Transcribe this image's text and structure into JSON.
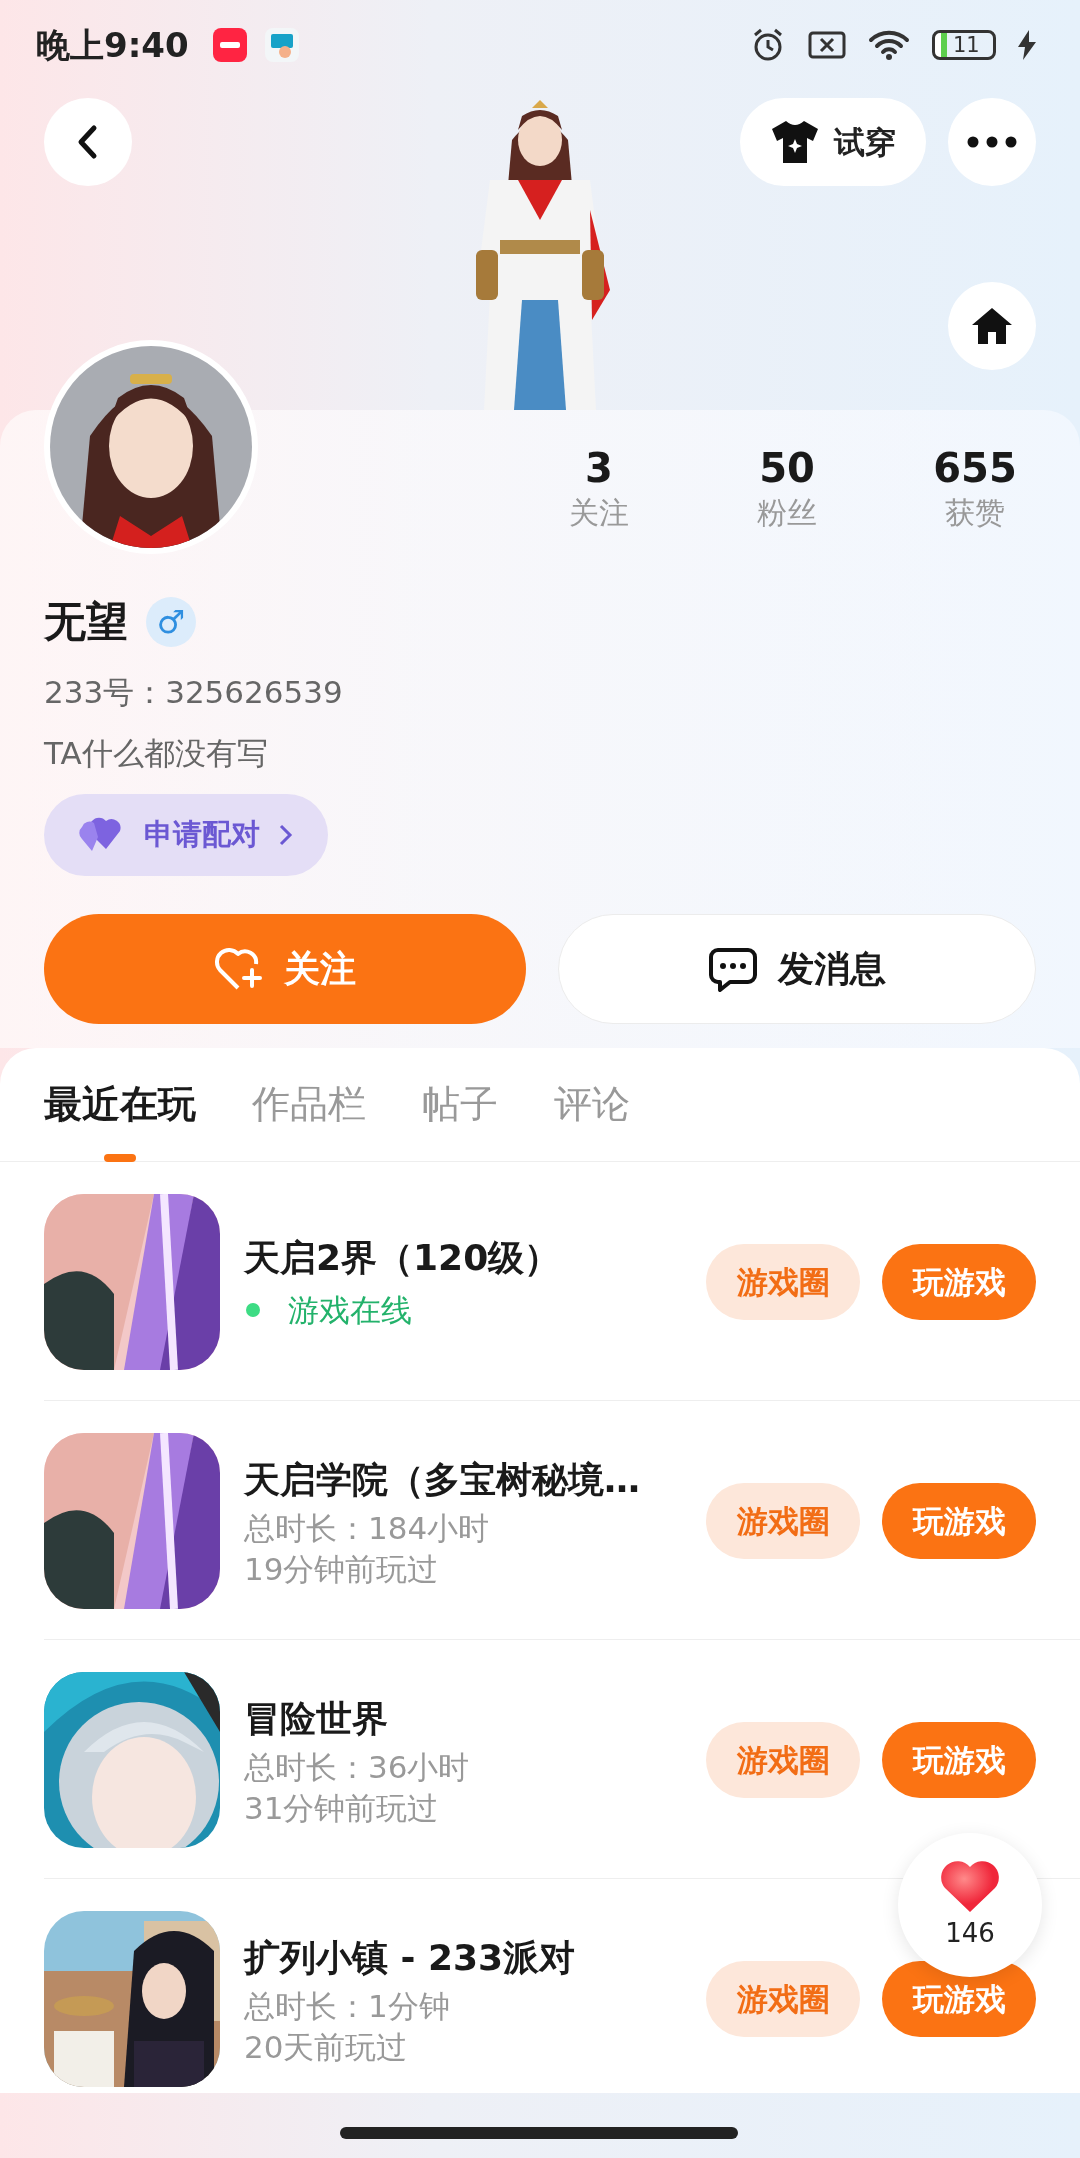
{
  "status_bar": {
    "time": "晚上9:40",
    "battery": "11"
  },
  "header": {
    "try_on": "试穿"
  },
  "profile": {
    "stats": [
      {
        "value": "3",
        "label": "关注"
      },
      {
        "value": "50",
        "label": "粉丝"
      },
      {
        "value": "655",
        "label": "获赞"
      }
    ],
    "name": "无望",
    "gender": "♂",
    "id_line": "233号：325626539",
    "bio": "TA什么都没有写",
    "pair_button": "申请配对",
    "follow_button": "关注",
    "message_button": "发消息"
  },
  "tabs": [
    {
      "label": "最近在玩",
      "selected": true
    },
    {
      "label": "作品栏",
      "selected": false
    },
    {
      "label": "帖子",
      "selected": false
    },
    {
      "label": "评论",
      "selected": false
    }
  ],
  "games": [
    {
      "kind": "online",
      "title": "天启2界（120级）",
      "status": "游戏在线",
      "circle_button": "游戏圈",
      "play_button": "玩游戏"
    },
    {
      "kind": "history",
      "title": "天启学院（多宝树秘境…",
      "duration": "总时长：184小时",
      "last_played": "19分钟前玩过",
      "circle_button": "游戏圈",
      "play_button": "玩游戏"
    },
    {
      "kind": "history",
      "title": "冒险世界",
      "duration": "总时长：36小时",
      "last_played": "31分钟前玩过",
      "circle_button": "游戏圈",
      "play_button": "玩游戏"
    },
    {
      "kind": "history",
      "title": "扩列小镇 - 233派对",
      "duration": "总时长：1分钟",
      "last_played": "20天前玩过",
      "circle_button": "游戏圈",
      "play_button": "玩游戏"
    }
  ],
  "like_float": {
    "count": "146"
  }
}
